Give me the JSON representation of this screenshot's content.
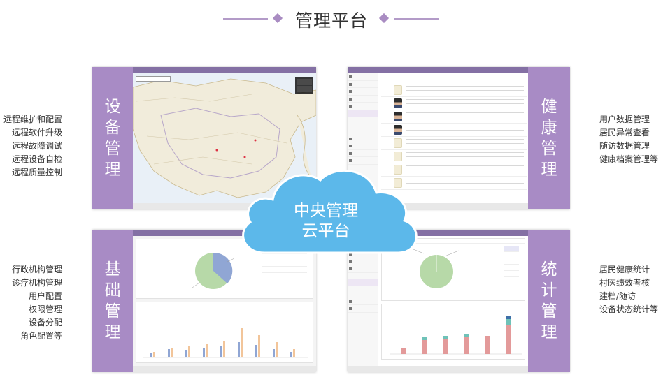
{
  "title": "管理平台",
  "cloud": {
    "line1": "中央管理",
    "line2": "云平台"
  },
  "left_top_list": [
    "远程维护和配置",
    "远程软件升级",
    "远程故障调试",
    "远程设备自检",
    "远程质量控制"
  ],
  "left_bottom_list": [
    "行政机构管理",
    "诊疗机构管理",
    "用户配置",
    "权限管理",
    "设备分配",
    "角色配置等"
  ],
  "right_top_list": [
    "用户数据管理",
    "居民异常查看",
    "随访数据管理",
    "健康档案管理等"
  ],
  "right_bottom_list": [
    "居民健康统计",
    "村医绩效考核",
    "建档/随访",
    "设备状态统计等"
  ],
  "labels": {
    "device": "设备管理",
    "health": "健康管理",
    "base": "基础管理",
    "stats": "统计管理"
  },
  "colors": {
    "purple": "#a88bc5",
    "cloud": "#5cb8ea",
    "title_line": "#b39bc8"
  }
}
